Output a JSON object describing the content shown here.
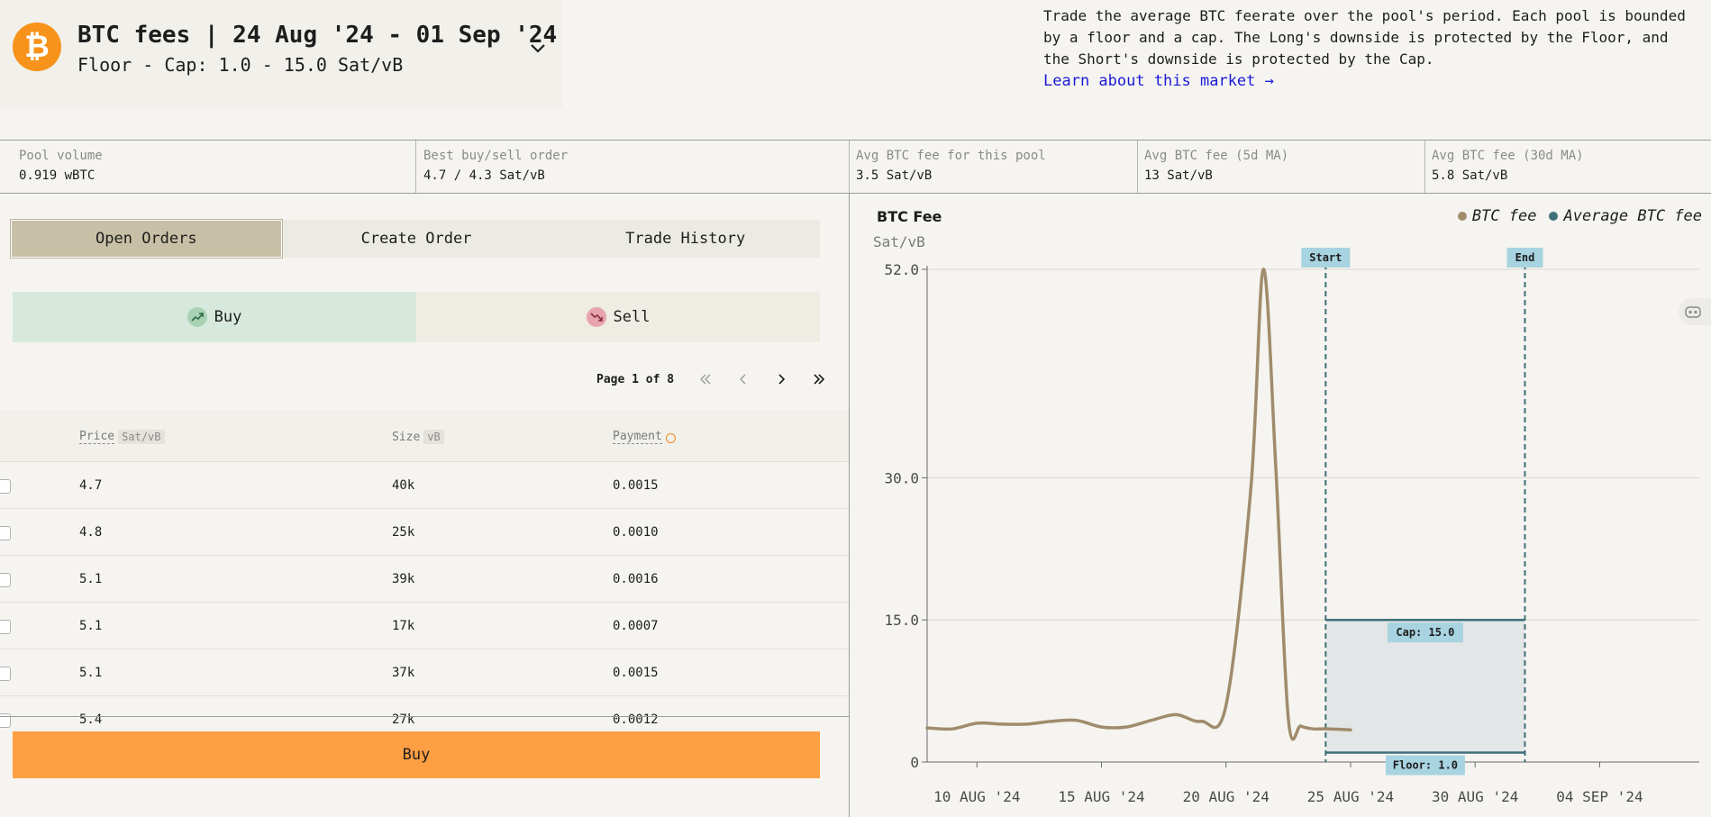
{
  "header": {
    "title": "BTC fees | 24 Aug '24 - 01 Sep '24",
    "subtitle": "Floor - Cap: 1.0 - 15.0 Sat/vB",
    "logo_symbol": "₿",
    "description": "Trade the average BTC feerate over the pool's period. Each pool is bounded by a floor and a cap. The Long's downside is protected by the Floor, and the Short's downside is protected by the Cap.",
    "learn_link": "Learn about this market →"
  },
  "stats": [
    {
      "label": "Pool volume",
      "value": "0.919 wBTC"
    },
    {
      "label": "Best buy/sell order",
      "value": "4.7 / 4.3 Sat/vB"
    },
    {
      "label": "Avg BTC fee for this pool",
      "value": "3.5 Sat/vB"
    },
    {
      "label": "Avg BTC fee (5d MA)",
      "value": "13 Sat/vB"
    },
    {
      "label": "Avg BTC fee (30d MA)",
      "value": "5.8 Sat/vB"
    }
  ],
  "tabs": [
    {
      "label": "Open Orders",
      "active": true
    },
    {
      "label": "Create Order",
      "active": false
    },
    {
      "label": "Trade History",
      "active": false
    }
  ],
  "side_toggle": {
    "buy": "Buy",
    "sell": "Sell",
    "selected": "Buy"
  },
  "pagination": {
    "text": "Page 1 of 8"
  },
  "orders_table": {
    "headers": {
      "price": "Price",
      "price_unit": "Sat/vB",
      "size": "Size",
      "size_unit": "vB",
      "payment": "Payment"
    },
    "rows": [
      {
        "price": "4.7",
        "size": "40k",
        "payment": "0.0015"
      },
      {
        "price": "4.8",
        "size": "25k",
        "payment": "0.0010"
      },
      {
        "price": "5.1",
        "size": "39k",
        "payment": "0.0016"
      },
      {
        "price": "5.1",
        "size": "17k",
        "payment": "0.0007"
      },
      {
        "price": "5.1",
        "size": "37k",
        "payment": "0.0015"
      },
      {
        "price": "5.4",
        "size": "27k",
        "payment": "0.0012"
      }
    ]
  },
  "action_button": "Buy",
  "colors": {
    "btc_fee": "#a08c6c",
    "average_btc_fee": "#3f6f78",
    "marker_bg": "#a8d3e0",
    "buy_button": "#ff9f43",
    "btc_orange": "#f7931a"
  },
  "chart_data": {
    "type": "line",
    "title": "BTC Fee",
    "ylabel": "Sat/vB",
    "ylim": [
      0,
      52
    ],
    "yticks": [
      0,
      15.0,
      30.0,
      52.0
    ],
    "ytick_labels": [
      "0",
      "15.0",
      "30.0",
      "52.0"
    ],
    "xlim": [
      "2024-08-08",
      "2024-09-08"
    ],
    "xticks": [
      "2024-08-10",
      "2024-08-15",
      "2024-08-20",
      "2024-08-25",
      "2024-08-30",
      "2024-09-04"
    ],
    "xtick_labels": [
      "10 AUG '24",
      "15 AUG '24",
      "20 AUG '24",
      "25 AUG '24",
      "30 AUG '24",
      "04 SEP '24"
    ],
    "legend": [
      "BTC fee",
      "Average BTC fee"
    ],
    "legend_position": "top-right",
    "grid": true,
    "series": [
      {
        "name": "BTC fee",
        "x": [
          "2024-08-08",
          "2024-08-09",
          "2024-08-10",
          "2024-08-11",
          "2024-08-12",
          "2024-08-13",
          "2024-08-14",
          "2024-08-15",
          "2024-08-16",
          "2024-08-17",
          "2024-08-18",
          "2024-08-19",
          "2024-08-20",
          "2024-08-21",
          "2024-08-21T12:00",
          "2024-08-22",
          "2024-08-22T12:00",
          "2024-08-23",
          "2024-08-23T12:00",
          "2024-08-24",
          "2024-08-25"
        ],
        "y": [
          3.6,
          3.5,
          4.1,
          4.0,
          4.0,
          4.3,
          4.4,
          3.7,
          3.7,
          4.4,
          5.0,
          4.3,
          6.0,
          29.0,
          52.0,
          31.0,
          4.6,
          3.8,
          3.5,
          3.5,
          3.4
        ]
      }
    ],
    "annotations": {
      "start": {
        "label": "Start",
        "x": "2024-08-24"
      },
      "end": {
        "label": "End",
        "x": "2024-09-01"
      },
      "cap": {
        "label": "Cap: 15.0",
        "y": 15.0
      },
      "floor": {
        "label": "Floor: 1.0",
        "y": 1.0
      }
    }
  }
}
